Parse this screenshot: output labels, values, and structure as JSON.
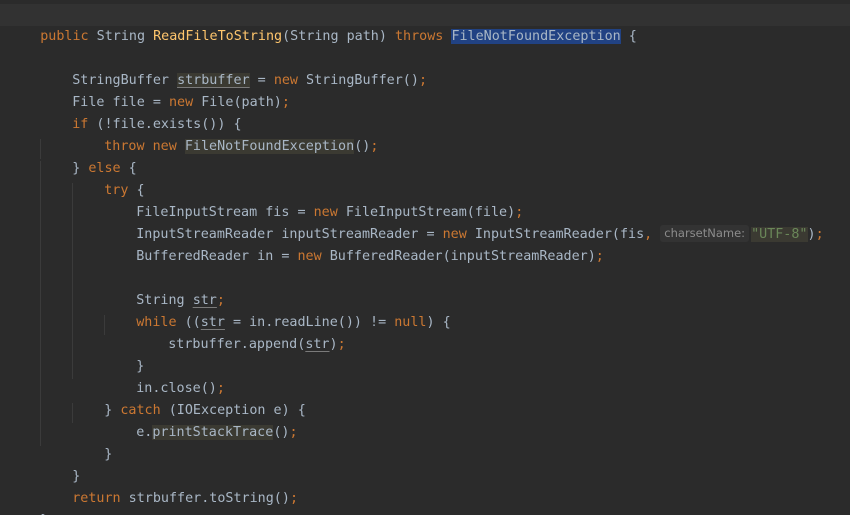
{
  "editor": {
    "signature": {
      "kw_public": "public",
      "type": " String ",
      "method": "ReadFileToString",
      "params": "(String path) ",
      "kw_throws": "throws",
      "sp": " ",
      "exception": "FileNotFoundException",
      "tail": " {"
    },
    "l3": {
      "a": "StringBuffer ",
      "var": "strbuffer",
      "b": " = ",
      "kw_new": "new",
      "c": " StringBuffer()",
      "semi": ";"
    },
    "l4": {
      "a": "File file = ",
      "kw_new": "new",
      "b": " File(path)",
      "semi": ";"
    },
    "l5": {
      "kw_if": "if",
      "b": " (!file.exists()) {"
    },
    "l6": {
      "kw_throw": "throw",
      "sp": " ",
      "kw_new": "new",
      "sp2": " ",
      "cls": "FileNotFoundException",
      "b": "()",
      "semi": ";"
    },
    "l7": {
      "a": "} ",
      "kw_else": "else",
      "b": " {"
    },
    "l8": {
      "kw_try": "try",
      "b": " {"
    },
    "l9": {
      "a": "FileInputStream fis = ",
      "kw_new": "new",
      "b": " FileInputStream(file)",
      "semi": ";"
    },
    "l10": {
      "a": "InputStreamReader inputStreamReader = ",
      "kw_new": "new",
      "b": " InputStreamReader(fis",
      "comma": ", ",
      "hint": "charsetName:",
      "str": "\"UTF-8\"",
      "c": ")",
      "semi": ";"
    },
    "l11": {
      "a": "BufferedReader in = ",
      "kw_new": "new",
      "b": " BufferedReader(inputStreamReader)",
      "semi": ";"
    },
    "l13": {
      "a": "String ",
      "var": "str",
      "semi": ";"
    },
    "l14": {
      "kw_while": "while",
      "a": " ((",
      "var": "str",
      "b": " = in.readLine()) != ",
      "kw_null": "null",
      "c": ") {"
    },
    "l15": {
      "a": "strbuffer.append(",
      "var": "str",
      "b": ")",
      "semi": ";"
    },
    "l16": {
      "a": "}"
    },
    "l17": {
      "a": "in.close()",
      "semi": ";"
    },
    "l18": {
      "a": "} ",
      "kw_catch": "catch",
      "b": " (IOException e) {"
    },
    "l19": {
      "a": "e.",
      "fn": "printStackTrace",
      "b": "()",
      "semi": ";"
    },
    "l20": {
      "a": "}"
    },
    "l21": {
      "a": "}"
    },
    "l22": {
      "kw_return": "return",
      "a": " strbuffer.toString()",
      "semi": ";"
    },
    "l23": {
      "a": "}"
    }
  },
  "colors": {
    "background": "#2b2b2b",
    "keyword": "#cc7832",
    "method": "#ffc66d",
    "string": "#6a8759",
    "text": "#a9b7c6",
    "search_highlight": "#214283"
  }
}
